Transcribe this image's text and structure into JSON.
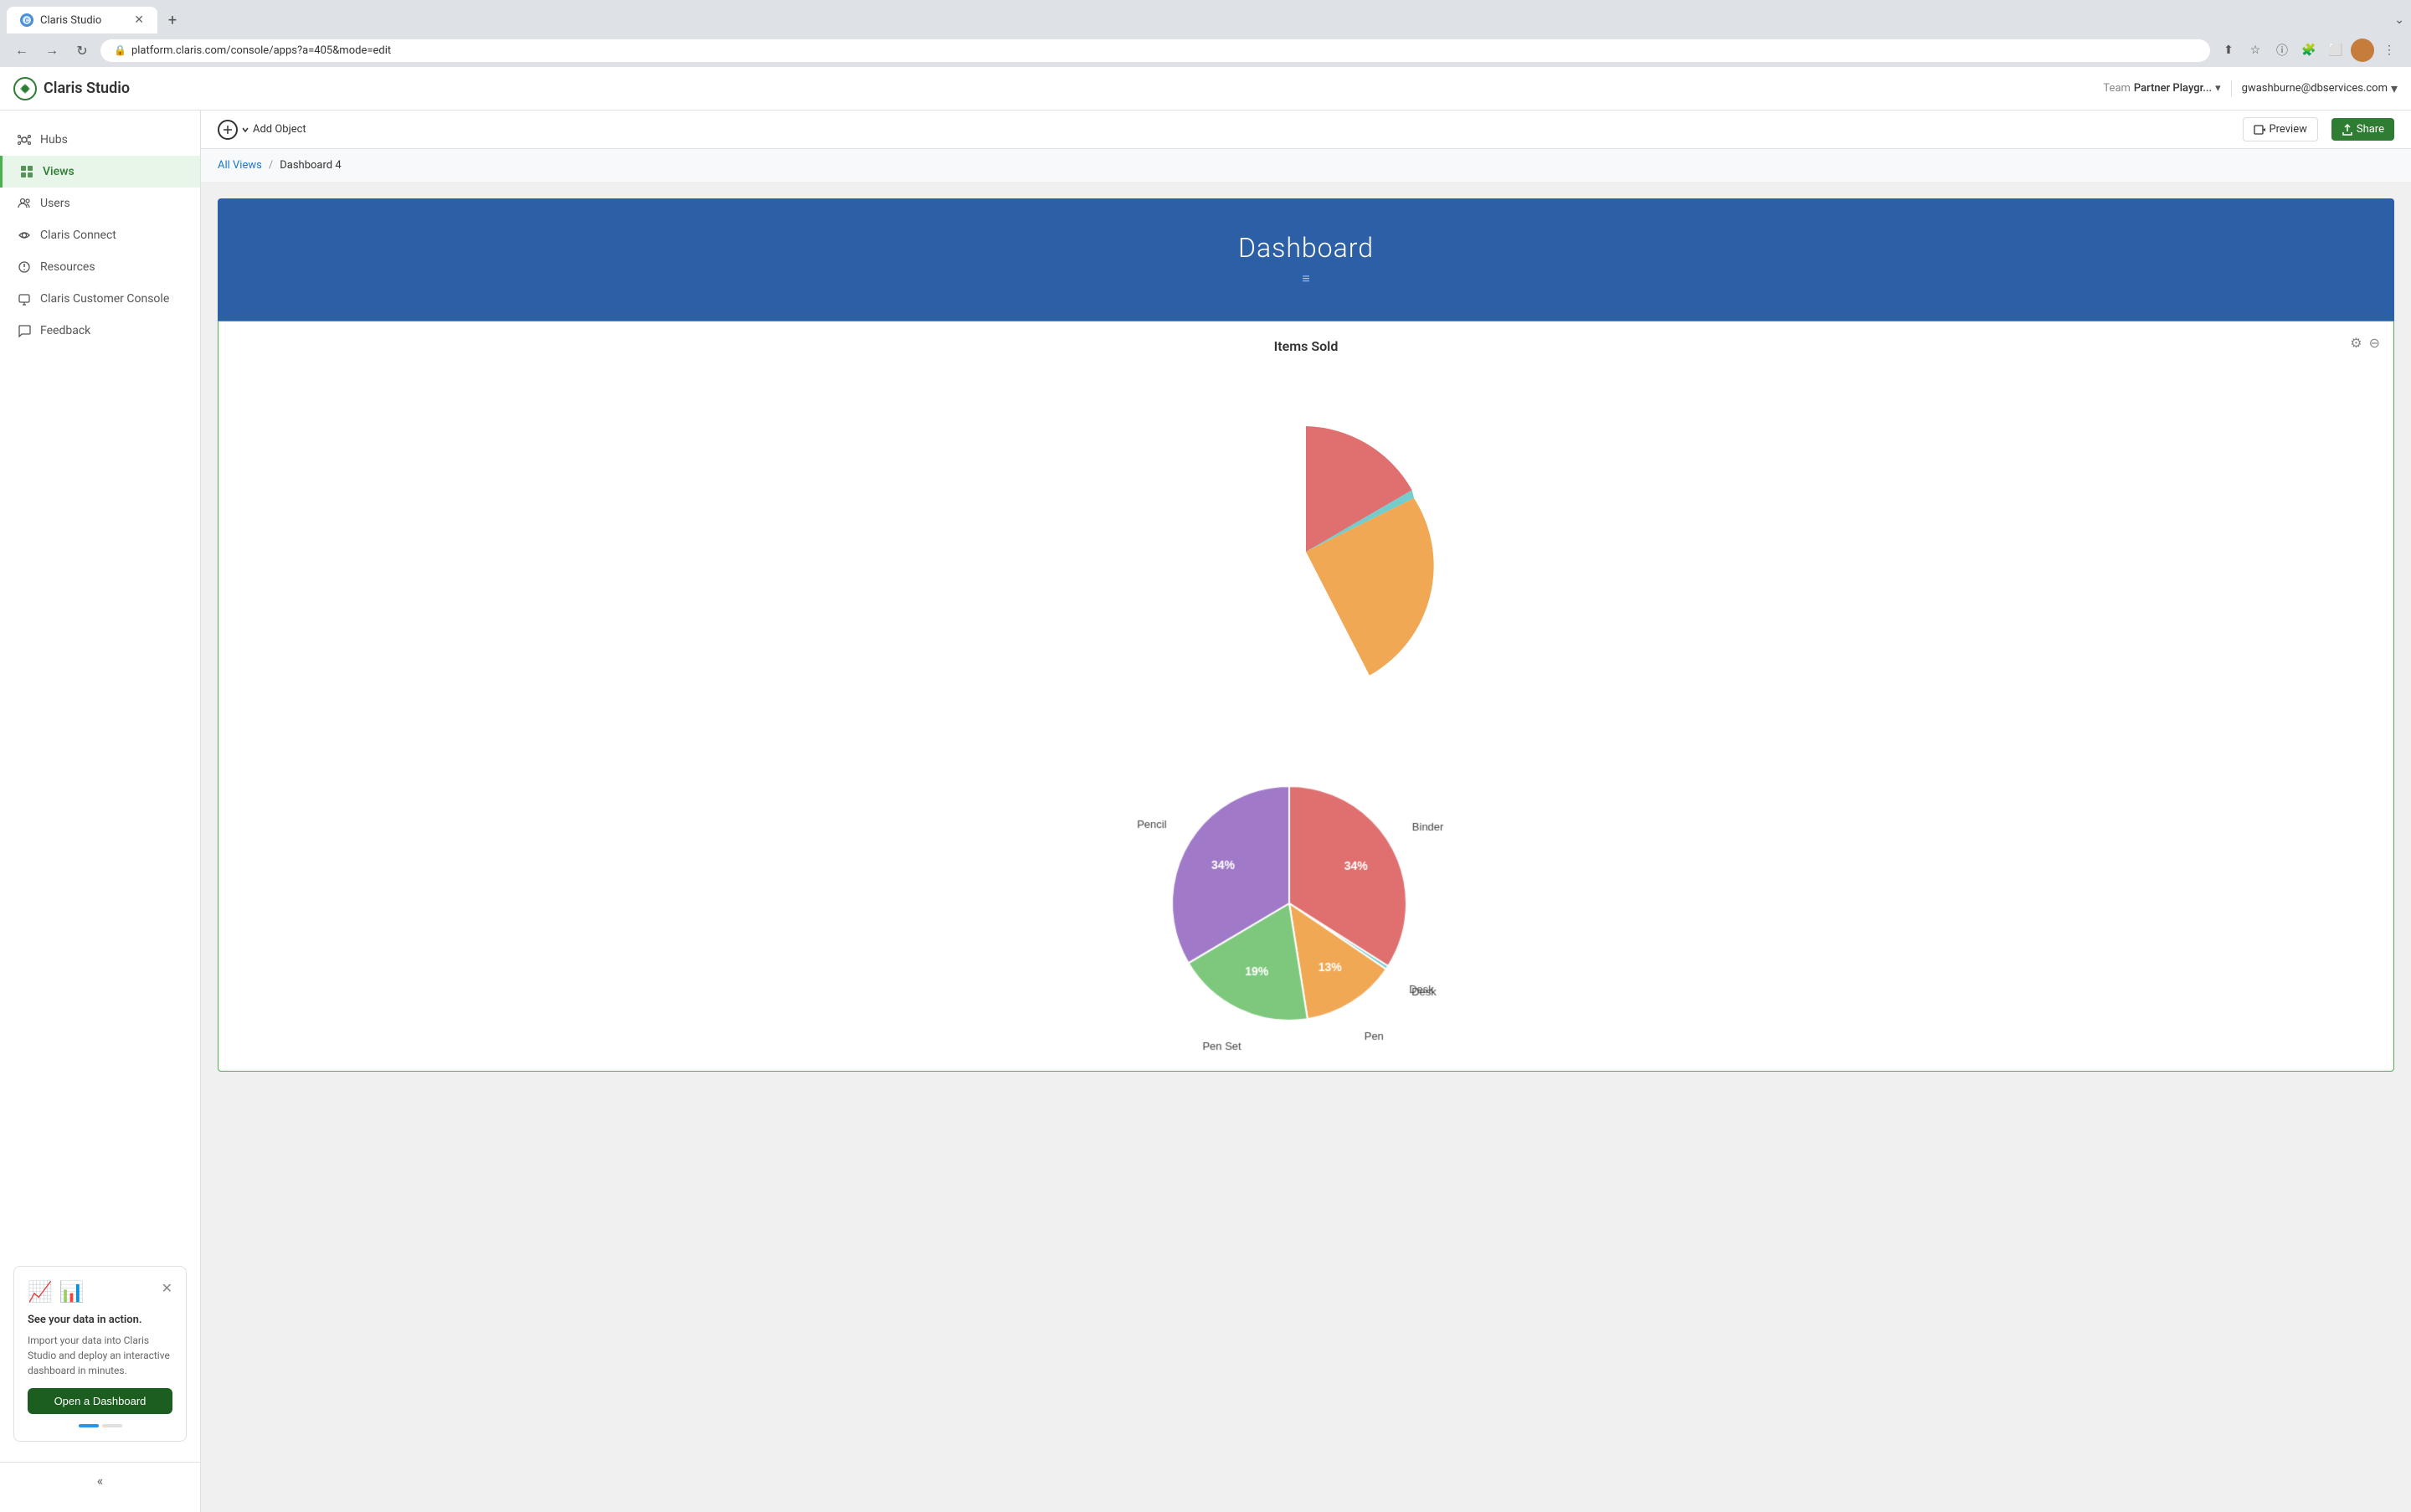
{
  "browser": {
    "tab_label": "Claris Studio",
    "tab_favicon": "CS",
    "url": "platform.claris.com/console/apps?a=405&mode=edit",
    "new_tab_icon": "+",
    "back_icon": "←",
    "forward_icon": "→",
    "refresh_icon": "↻"
  },
  "header": {
    "logo_text": "Claris Studio",
    "team_label": "Team",
    "team_name": "Partner Playgr...",
    "user_email": "gwashburne@dbservices.com"
  },
  "sidebar": {
    "items": [
      {
        "id": "hubs",
        "label": "Hubs",
        "icon": "hub"
      },
      {
        "id": "views",
        "label": "Views",
        "icon": "views",
        "active": true
      },
      {
        "id": "users",
        "label": "Users",
        "icon": "users"
      },
      {
        "id": "claris-connect",
        "label": "Claris Connect",
        "icon": "connect"
      },
      {
        "id": "resources",
        "label": "Resources",
        "icon": "resources"
      },
      {
        "id": "claris-customer-console",
        "label": "Claris Customer Console",
        "icon": "console"
      },
      {
        "id": "feedback",
        "label": "Feedback",
        "icon": "feedback"
      }
    ],
    "promo": {
      "title": "See your data in action.",
      "description": "Import your data into Claris Studio and deploy an interactive dashboard in minutes.",
      "button_label": "Open a Dashboard"
    },
    "collapse_icon": "«"
  },
  "toolbar": {
    "add_object_label": "Add Object",
    "preview_label": "Preview",
    "share_label": "Share"
  },
  "breadcrumb": {
    "all_views": "All Views",
    "separator": "/",
    "current": "Dashboard 4"
  },
  "dashboard": {
    "title": "Dashboard",
    "subtitle": "≡"
  },
  "chart": {
    "title": "Items Sold",
    "segments": [
      {
        "label": "Binder",
        "percent": 34,
        "color": "#e07070",
        "startAngle": -90,
        "endAngle": 32
      },
      {
        "label": "Desk",
        "percent": 0,
        "color": "#74cccc",
        "startAngle": 32,
        "endAngle": 35
      },
      {
        "label": "Pen",
        "percent": 13,
        "color": "#f0a855",
        "startAngle": 35,
        "endAngle": 82
      },
      {
        "label": "Pen Set",
        "percent": 19,
        "color": "#7ec87e",
        "startAngle": 82,
        "endAngle": 151
      },
      {
        "label": "Pencil",
        "percent": 34,
        "color": "#a07ac8",
        "startAngle": 151,
        "endAngle": 270
      }
    ]
  }
}
